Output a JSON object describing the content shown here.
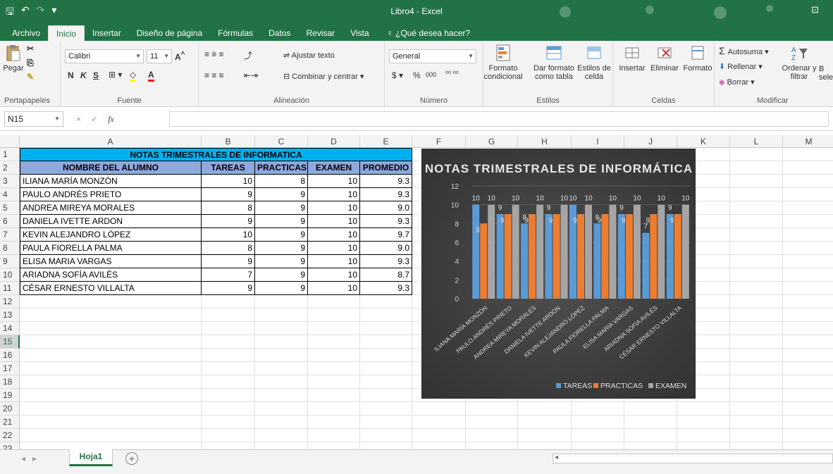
{
  "window": {
    "title": "Libro4 - Excel"
  },
  "ribbon_tabs": [
    "Archivo",
    "Inicio",
    "Insertar",
    "Diseño de página",
    "Fórmulas",
    "Datos",
    "Revisar",
    "Vista"
  ],
  "tell_me": "¿Qué desea hacer?",
  "ribbon": {
    "clipboard": {
      "paste": "Pegar",
      "label": "Portapapeles"
    },
    "font": {
      "name": "Calibri",
      "size": "11",
      "bold": "N",
      "italic": "K",
      "underline": "S",
      "label": "Fuente"
    },
    "alignment": {
      "wrap": "Ajustar texto",
      "merge": "Combinar y centrar",
      "label": "Alineación"
    },
    "number": {
      "format": "General",
      "currency": "$",
      "percent": "%",
      "thousands": "000",
      "label": "Número"
    },
    "styles": {
      "conditional1": "Formato",
      "conditional2": "condicional",
      "table1": "Dar formato",
      "table2": "como tabla",
      "cell1": "Estilos de",
      "cell2": "celda",
      "label": "Estilos"
    },
    "cells": {
      "insert": "Insertar",
      "delete": "Eliminar",
      "format": "Formato",
      "label": "Celdas"
    },
    "editing": {
      "autosum": "Autosuma",
      "fill": "Rellenar",
      "clear": "Borrar",
      "sort1": "Ordenar y",
      "sort2": "filtrar",
      "select_partial": "B",
      "select_partial2": "sele",
      "label": "Modificar"
    }
  },
  "formula_bar": {
    "name_box": "N15",
    "cancel": "×",
    "enter": "✓",
    "fx": "fx",
    "value": ""
  },
  "columns": [
    "A",
    "B",
    "C",
    "D",
    "E",
    "F",
    "G",
    "H",
    "I",
    "J",
    "K",
    "L",
    "M"
  ],
  "rows": [
    "1",
    "2",
    "3",
    "4",
    "5",
    "6",
    "7",
    "8",
    "9",
    "10",
    "11",
    "12",
    "13",
    "14",
    "15",
    "16",
    "17",
    "18",
    "19",
    "20",
    "21",
    "22",
    "23"
  ],
  "sheet": {
    "title": "NOTAS TRIMESTRALES DE INFORMATICA",
    "headers": [
      "NOMBRE DEL ALUMNO",
      "TAREAS",
      "PRACTICAS",
      "EXAMEN",
      "PROMEDIO"
    ],
    "students": [
      {
        "name": "ILIANA MARÍA MONZÓN",
        "tareas": "10",
        "practicas": "8",
        "examen": "10",
        "promedio": "9.3"
      },
      {
        "name": "PAULO ANDRÉS PRIETO",
        "tareas": "9",
        "practicas": "9",
        "examen": "10",
        "promedio": "9.3"
      },
      {
        "name": "ANDREA MIREYA MORALES",
        "tareas": "8",
        "practicas": "9",
        "examen": "10",
        "promedio": "9.0"
      },
      {
        "name": "DANIELA IVETTE ARDON",
        "tareas": "9",
        "practicas": "9",
        "examen": "10",
        "promedio": "9.3"
      },
      {
        "name": "KEVIN ALEJANDRO LÓPEZ",
        "tareas": "10",
        "practicas": "9",
        "examen": "10",
        "promedio": "9.7"
      },
      {
        "name": "PAULA FIORELLA PALMA",
        "tareas": "8",
        "practicas": "9",
        "examen": "10",
        "promedio": "9.0"
      },
      {
        "name": "ELISA MARIA VARGAS",
        "tareas": "9",
        "practicas": "9",
        "examen": "10",
        "promedio": "9.3"
      },
      {
        "name": "ARIADNA SOFÍA AVILÉS",
        "tareas": "7",
        "practicas": "9",
        "examen": "10",
        "promedio": "8.7"
      },
      {
        "name": "CÉSAR ERNESTO VILLALTA",
        "tareas": "9",
        "practicas": "9",
        "examen": "10",
        "promedio": "9.3"
      }
    ]
  },
  "chart_data": {
    "type": "bar",
    "title": "NOTAS TRIMESTRALES DE INFORMÁTICA",
    "categories": [
      "ILIANA MARÍA MONZÓN",
      "PAULO ANDRÉS PRIETO",
      "ANDREA MIREYA MORALES",
      "DANIELA IVETTE ARDON",
      "KEVIN ALEJANDRO LÓPEZ",
      "PAULA FIORELLA PALMA",
      "ELISA MARIA VARGAS",
      "ARIADNA SOFÍA AVILÉS",
      "CÉSAR ERNESTO VILLALTA"
    ],
    "series": [
      {
        "name": "TAREAS",
        "color": "#5b9bd5",
        "values": [
          10,
          9,
          8,
          9,
          10,
          8,
          9,
          7,
          9
        ]
      },
      {
        "name": "PRACTICAS",
        "color": "#ed7d31",
        "values": [
          8,
          9,
          9,
          9,
          9,
          9,
          9,
          9,
          9
        ]
      },
      {
        "name": "EXAMEN",
        "color": "#a5a5a5",
        "values": [
          10,
          10,
          10,
          10,
          10,
          10,
          10,
          10,
          10
        ]
      }
    ],
    "ylim": [
      0,
      12
    ],
    "yticks": [
      "0",
      "2",
      "4",
      "6",
      "8",
      "10",
      "12"
    ],
    "legend_position": "bottom",
    "grid": true
  },
  "sheet_tabs": {
    "active": "Hoja1",
    "add": "+"
  }
}
